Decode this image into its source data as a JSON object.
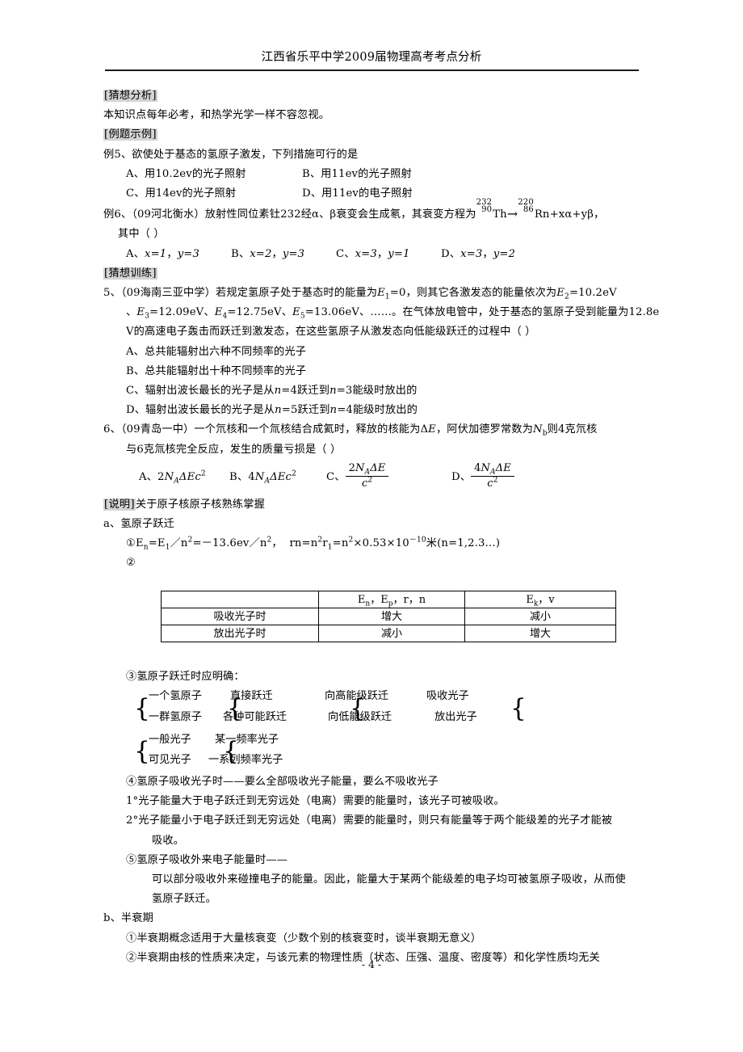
{
  "document": {
    "header_title": "江西省乐平中学2009届物理高考考点分析",
    "footer": "- 4 -"
  },
  "sections": {
    "guess_analysis_tag": "[猜想分析]",
    "guess_analysis_text": "本知识点每年必考，和热学光学一样不容忽视。",
    "example_tag": "[例题示例]",
    "training_tag": "[猜想训练]",
    "note_tag": "[说明]",
    "note_text": "关于原子核原子核熟练掌握"
  },
  "example5": {
    "stem": "例5、欲使处于基态的氢原子激发，下列措施可行的是",
    "options": [
      {
        "label": "A、用10.2ev的光子照射"
      },
      {
        "label": "B、用11ev的光子照射"
      },
      {
        "label": "C、用14ev的光子照射"
      },
      {
        "label": "D、用11ev的电子照射"
      }
    ]
  },
  "example6": {
    "stem_pre": "例6、（09河北衡水）放射性同位素钍232经α、β衰变会生成氡，其衰变方程为",
    "equation": {
      "left_mass": "232",
      "left_atomic": "90",
      "left_symbol": "Th",
      "arrow": "→",
      "right_mass": "220",
      "right_atomic": "86",
      "right_symbol": "Rn+xα+yβ",
      "trailing": "，"
    },
    "stem_post": "其中（   ）",
    "options": [
      {
        "letter": "A、",
        "x": "x=1",
        "sep": "，",
        "y": "y=3"
      },
      {
        "letter": "B、",
        "x": "x=2",
        "sep": "，",
        "y": "y=3"
      },
      {
        "letter": "C、",
        "x": "x=3",
        "sep": "，",
        "y": "y=1"
      },
      {
        "letter": "D、",
        "x": "x=3",
        "sep": "，",
        "y": "y=2"
      }
    ]
  },
  "question5": {
    "line1_a": "5、（09海南三亚中学）若规定氢原子处于基态时的能量为",
    "line1_e1": "E",
    "line1_e1_sub": "1",
    "line1_b": "=0，则其它各激发态的能量依次为",
    "line1_e2": "E",
    "line1_e2_sub": "2",
    "line1_c": "=10.2eV",
    "line2_a": "、",
    "line2_e3": "E",
    "line2_e3_sub": "3",
    "line2_b": "=12.09eV、",
    "line2_e4": "E",
    "line2_e4_sub": "4",
    "line2_c": "=12.75eV、",
    "line2_e5": "E",
    "line2_e5_sub": "5",
    "line2_d": "=13.06eV、……。在气体放电管中，处于基态的氢原子受到能量为12.8e",
    "line3": "V的高速电子轰击而跃迁到激发态，在这些氢原子从激发态向低能级跃迁的过程中（ ）",
    "options": [
      {
        "pre": "A、总共能辐射出六种不同频率的光子"
      },
      {
        "pre": "B、总共能辐射出十种不同频率的光子"
      },
      {
        "pre": "C、辐射出波长最长的光子是从",
        "n1": "n",
        "mid": "=4跃迁到",
        "n2": "n",
        "post": "=3能级时放出的"
      },
      {
        "pre": "D、辐射出波长最长的光子是从",
        "n1": "n",
        "mid": "=5跃迁到",
        "n2": "n",
        "post": "=4能级时放出的"
      }
    ]
  },
  "question6": {
    "line1_a": "6、（09青岛一中）一个氘核和一个氚核结合成氦时，释放的核能为Δ",
    "line1_e": "E",
    "line1_b": "，阿伏加德罗常数为",
    "line1_n": "N",
    "line1_n_sub": "b",
    "line1_c": "则4克氘核",
    "line2": "与6克氚核完全反应，发生的质量亏损是（        ）",
    "options": [
      {
        "letter": "A、",
        "type": "plain",
        "coef": "2",
        "N": "N",
        "Nsub": "A",
        "delta": "ΔEc",
        "sup": "2"
      },
      {
        "letter": "B、",
        "type": "plain",
        "coef": "4",
        "N": "N",
        "Nsub": "A",
        "delta": "ΔEc",
        "sup": "2"
      },
      {
        "letter": "C、",
        "type": "frac",
        "num_coef": "2",
        "num_N": "N",
        "num_Nsub": "A",
        "num_rest": "ΔE",
        "den": "c",
        "den_sup": "2"
      },
      {
        "letter": "D、",
        "type": "frac",
        "num_coef": "4",
        "num_N": "N",
        "num_Nsub": "A",
        "num_rest": "ΔE",
        "den": "c",
        "den_sup": "2"
      }
    ]
  },
  "notes": {
    "item_a": "a、氢原子跃迁",
    "formula1": {
      "marker": "①",
      "e": "E",
      "e_sub": "n",
      "eq1": "=E",
      "e1_sub": "1",
      "slash1": "／n",
      "n_sup1": "2",
      "eq2": "=－13.6ev",
      "slash2": "／n",
      "n_sup2": "2",
      "comma": "，",
      "r": "rn=n",
      "r_sup1": "2",
      "r2": "r",
      "r2_sub": "1",
      "r3": "=n",
      "r_sup2": "2",
      "r4": "×0.53×10",
      "r_sup3": "－10",
      "r5": "米(n=1,2.3…)"
    },
    "formula2_marker": "②",
    "item3": "③氢原子跃迁时应明确：",
    "item4": "④氢原子吸收光子时——要么全部吸收光子能量，要么不吸收光子",
    "item4_1": "1°光子能量大于电子跃迁到无穷远处（电离）需要的能量时，该光子可被吸收。",
    "item4_2a": "2°光子能量小于电子跃迁到无穷远处（电离）需要的能量时，则只有能量等于两个能级差的光子才能被",
    "item4_2b": "吸收。",
    "item5": "⑤氢原子吸收外来电子能量时——",
    "item5_a": "可以部分吸收外来碰撞电子的能量。因此，能量大于某两个能级差的电子均可被氢原子吸收，从而使",
    "item5_b": "氢原子跃迁。",
    "item_b": "b、半衰期",
    "item_b1": "①半衰期概念适用于大量核衰变（少数个别的核衰变时，谈半衰期无意义）",
    "item_b2": "②半衰期由核的性质来决定，与该元素的物理性质（状态、压强、温度、密度等）和化学性质均无关"
  },
  "table": {
    "columns": [
      {
        "header": ""
      },
      {
        "header_parts": [
          "E",
          "n",
          "，",
          "E",
          "p",
          "，r，n"
        ]
      },
      {
        "header_parts": [
          "E",
          "k",
          "，v"
        ]
      }
    ],
    "header_col1": "",
    "header_col2_e1": "E",
    "header_col2_e1_sub": "n",
    "header_col2_mid": "，",
    "header_col2_e2": "E",
    "header_col2_e2_sub": "p",
    "header_col2_rest": "，r，n",
    "header_col3_e": "E",
    "header_col3_sub": "k",
    "header_col3_rest": "，v",
    "rows": [
      {
        "label": "吸收光子时",
        "col2": "增大",
        "col3": "减小"
      },
      {
        "label": "放出光子时",
        "col2": "减小",
        "col3": "增大"
      }
    ]
  },
  "brace_diagram": {
    "group1": {
      "row1": [
        "一个氢原子",
        "直接跃迁",
        "向高能级跃迁",
        "吸收光子"
      ],
      "row2": [
        "一群氢原子",
        "各种可能跃迁",
        "向低能级跃迁",
        "放出光子"
      ]
    },
    "group2": {
      "row1": [
        "一般光子",
        "某一频率光子"
      ],
      "row2": [
        "可见光子",
        "一系列频率光子"
      ]
    },
    "brace_glyph": "{"
  }
}
